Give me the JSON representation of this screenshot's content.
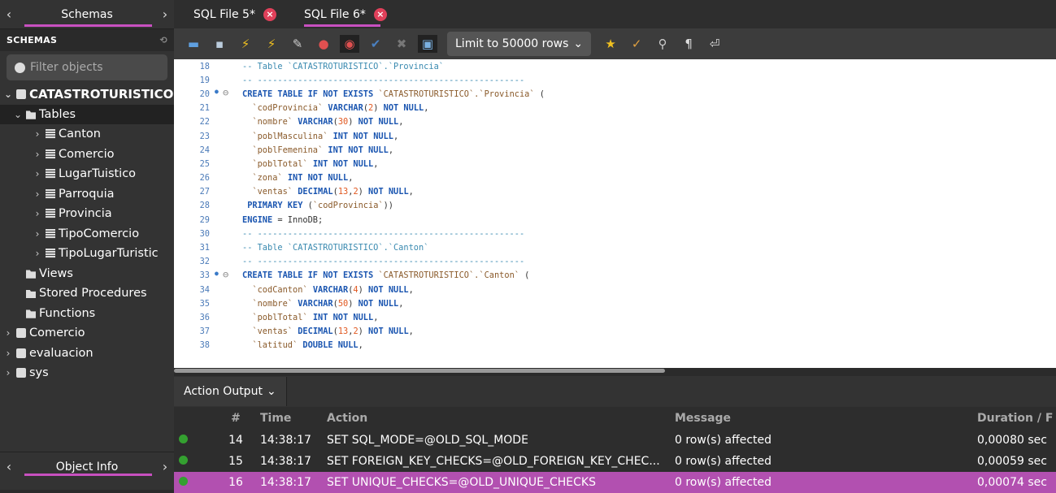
{
  "sidebar": {
    "header_title": "Schemas",
    "schemas_label": "SCHEMAS",
    "filter_placeholder": "Filter objects",
    "tree": [
      {
        "label": "CATASTROTURISTICO",
        "level": 0,
        "chevron": "⌄",
        "icon": "db"
      },
      {
        "label": "Tables",
        "level": 1,
        "chevron": "⌄",
        "icon": "fld"
      },
      {
        "label": "Canton",
        "level": 2,
        "chevron": "›",
        "icon": "tbl"
      },
      {
        "label": "Comercio",
        "level": 2,
        "chevron": "›",
        "icon": "tbl"
      },
      {
        "label": "LugarTuistico",
        "level": 2,
        "chevron": "›",
        "icon": "tbl"
      },
      {
        "label": "Parroquia",
        "level": 2,
        "chevron": "›",
        "icon": "tbl"
      },
      {
        "label": "Provincia",
        "level": 2,
        "chevron": "›",
        "icon": "tbl"
      },
      {
        "label": "TipoComercio",
        "level": 2,
        "chevron": "›",
        "icon": "tbl"
      },
      {
        "label": "TipoLugarTuristic",
        "level": 2,
        "chevron": "›",
        "icon": "tbl"
      },
      {
        "label": "Views",
        "level": 1,
        "chevron": "",
        "icon": "fld"
      },
      {
        "label": "Stored Procedures",
        "level": 1,
        "chevron": "",
        "icon": "fld"
      },
      {
        "label": "Functions",
        "level": 1,
        "chevron": "",
        "icon": "fld"
      },
      {
        "label": "Comercio",
        "level": 0,
        "chevron": "›",
        "icon": "db"
      },
      {
        "label": "evaluacion",
        "level": 0,
        "chevron": "›",
        "icon": "db"
      },
      {
        "label": "sys",
        "level": 0,
        "chevron": "›",
        "icon": "db"
      }
    ],
    "object_info_label": "Object Info"
  },
  "tabs": [
    {
      "label": "SQL File 5*"
    },
    {
      "label": "SQL File 6*"
    }
  ],
  "toolbar": {
    "limit_label": "Limit to 50000 rows"
  },
  "editor": {
    "lines": [
      {
        "n": "18",
        "html": "<span class='cm'>-- Table `CATASTROTURISTICO`.`Provincia`</span>"
      },
      {
        "n": "19",
        "html": "<span class='cm'>-- -----------------------------------------------------</span>"
      },
      {
        "n": "20",
        "dot": true,
        "fold": true,
        "html": "<span class='kw'>CREATE TABLE IF NOT EXISTS</span> <span class='str'>`CATASTROTURISTICO`.`Provincia`</span> ("
      },
      {
        "n": "21",
        "html": "  <span class='str'>`codProvincia`</span> <span class='kw'>VARCHAR</span>(<span class='numl'>2</span>) <span class='kw'>NOT NULL</span>,"
      },
      {
        "n": "22",
        "html": "  <span class='str'>`nombre`</span> <span class='kw'>VARCHAR</span>(<span class='numl'>30</span>) <span class='kw'>NOT NULL</span>,"
      },
      {
        "n": "23",
        "html": "  <span class='str'>`poblMasculina`</span> <span class='kw'>INT NOT NULL</span>,"
      },
      {
        "n": "24",
        "html": "  <span class='str'>`poblFemenina`</span> <span class='kw'>INT NOT NULL</span>,"
      },
      {
        "n": "25",
        "html": "  <span class='str'>`poblTotal`</span> <span class='kw'>INT NOT NULL</span>,"
      },
      {
        "n": "26",
        "html": "  <span class='str'>`zona`</span> <span class='kw'>INT NOT NULL</span>,"
      },
      {
        "n": "27",
        "html": "  <span class='str'>`ventas`</span> <span class='kw'>DECIMAL</span>(<span class='numl'>13</span>,<span class='numl'>2</span>) <span class='kw'>NOT NULL</span>,"
      },
      {
        "n": "28",
        "html": " <span class='kw'>PRIMARY KEY</span> (<span class='str'>`codProvincia`</span>))"
      },
      {
        "n": "29",
        "html": "<span class='kw'>ENGINE</span> = InnoDB;"
      },
      {
        "n": "30",
        "html": "<span class='cm'>-- -----------------------------------------------------</span>"
      },
      {
        "n": "31",
        "html": "<span class='cm'>-- Table `CATASTROTURISTICO`.`Canton`</span>"
      },
      {
        "n": "32",
        "html": "<span class='cm'>-- -----------------------------------------------------</span>"
      },
      {
        "n": "33",
        "dot": true,
        "fold": true,
        "html": "<span class='kw'>CREATE TABLE IF NOT EXISTS</span> <span class='str'>`CATASTROTURISTICO`.`Canton`</span> ("
      },
      {
        "n": "34",
        "html": "  <span class='str'>`codCanton`</span> <span class='kw'>VARCHAR</span>(<span class='numl'>4</span>) <span class='kw'>NOT NULL</span>,"
      },
      {
        "n": "35",
        "html": "  <span class='str'>`nombre`</span> <span class='kw'>VARCHAR</span>(<span class='numl'>50</span>) <span class='kw'>NOT NULL</span>,"
      },
      {
        "n": "36",
        "html": "  <span class='str'>`poblTotal`</span> <span class='kw'>INT NOT NULL</span>,"
      },
      {
        "n": "37",
        "html": "  <span class='str'>`ventas`</span> <span class='kw'>DECIMAL</span>(<span class='numl'>13</span>,<span class='numl'>2</span>) <span class='kw'>NOT NULL</span>,"
      },
      {
        "n": "38",
        "html": "  <span class='str'>`latitud`</span> <span class='kw'>DOUBLE NULL</span>,"
      }
    ]
  },
  "output": {
    "selector_label": "Action Output",
    "columns": [
      "#",
      "Time",
      "Action",
      "Message",
      "Duration / F"
    ],
    "rows": [
      {
        "n": "14",
        "time": "14:38:17",
        "action": "SET SQL_MODE=@OLD_SQL_MODE",
        "message": "0 row(s) affected",
        "duration": "0,00080 sec"
      },
      {
        "n": "15",
        "time": "14:38:17",
        "action": "SET FOREIGN_KEY_CHECKS=@OLD_FOREIGN_KEY_CHEC...",
        "message": "0 row(s) affected",
        "duration": "0,00059 sec"
      },
      {
        "n": "16",
        "time": "14:38:17",
        "action": "SET UNIQUE_CHECKS=@OLD_UNIQUE_CHECKS",
        "message": "0 row(s) affected",
        "duration": "0,00074 sec"
      }
    ]
  },
  "colors": {
    "accent": "#c850c0",
    "selected_row": "#b250b0",
    "success": "#34a030",
    "close_tab": "#e0405a"
  }
}
